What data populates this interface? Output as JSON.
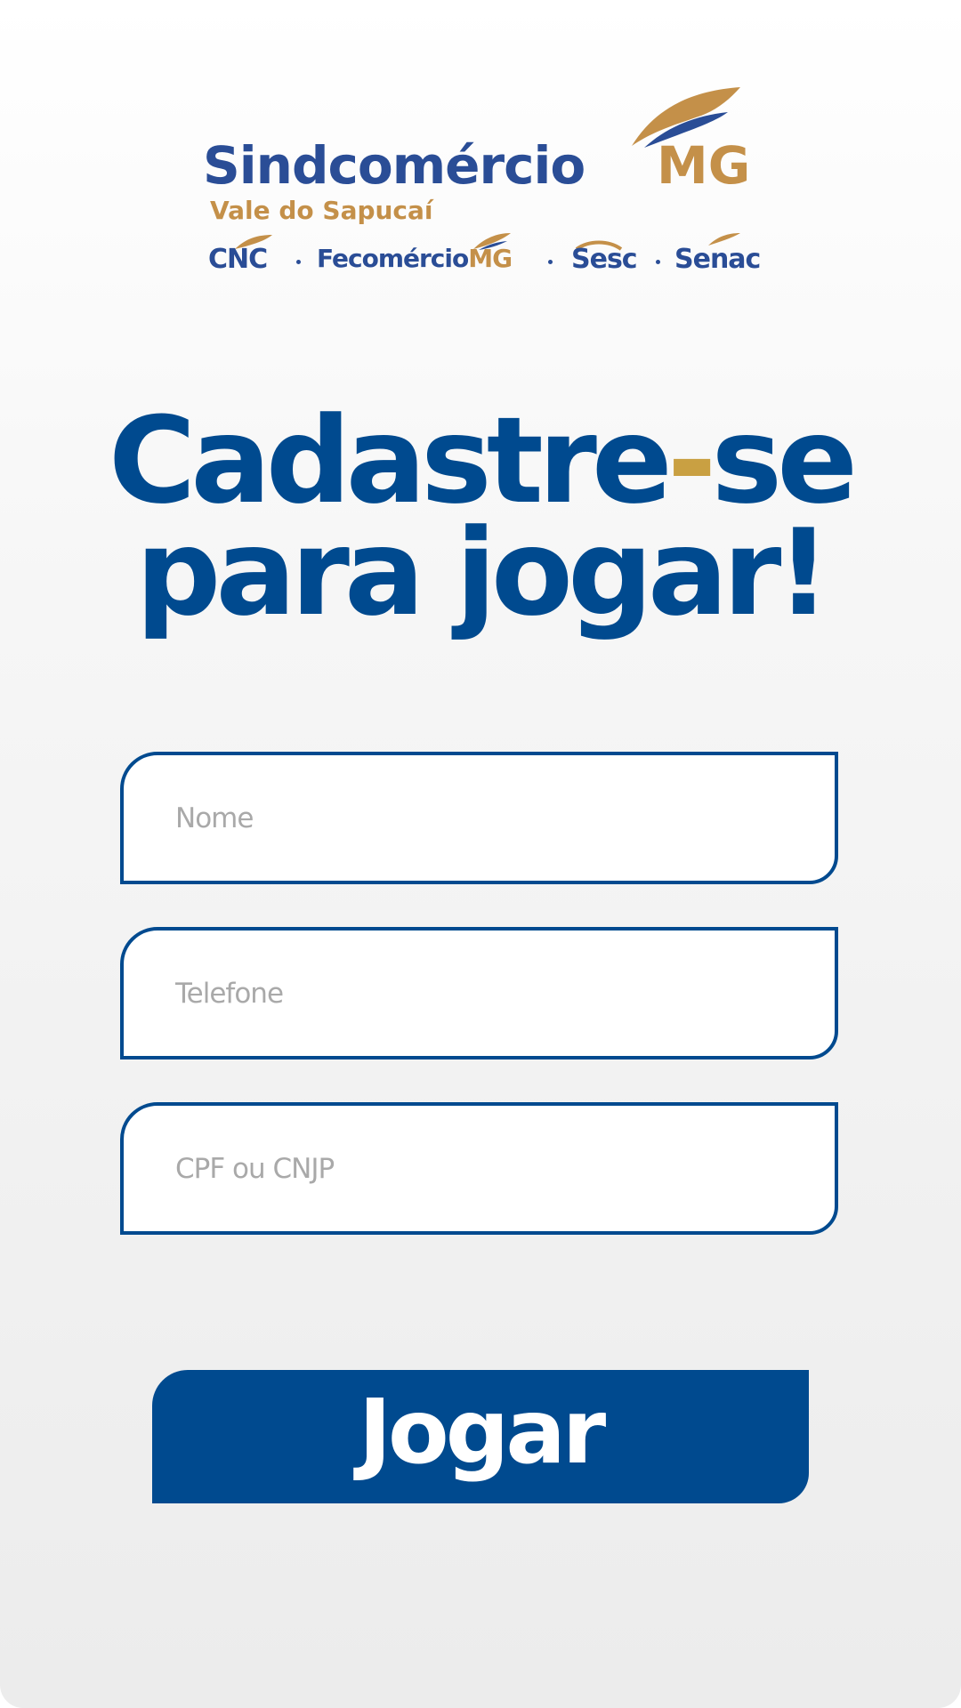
{
  "logo": {
    "brand_name": "Sindcomércio",
    "brand_suffix": "MG",
    "region": "Vale do Sapucaí",
    "partners": [
      {
        "name": "CNC"
      },
      {
        "name": "Fecomércio",
        "suffix": "MG"
      },
      {
        "name": "Sesc"
      },
      {
        "name": "Senac"
      }
    ],
    "colors": {
      "blue": "#2a4d96",
      "gold": "#c49049"
    }
  },
  "title": {
    "line1_part1": "Cadastre",
    "line1_dash": "-",
    "line1_part2": "se",
    "line2": "para jogar!"
  },
  "form": {
    "name_placeholder": "Nome",
    "phone_placeholder": "Telefone",
    "document_placeholder": "CPF ou CNJP",
    "name_value": "",
    "phone_value": "",
    "document_value": ""
  },
  "submit": {
    "label": "Jogar"
  },
  "colors": {
    "primary": "#004a8f",
    "accent": "#c9a042",
    "placeholder": "#a9a9a9"
  }
}
